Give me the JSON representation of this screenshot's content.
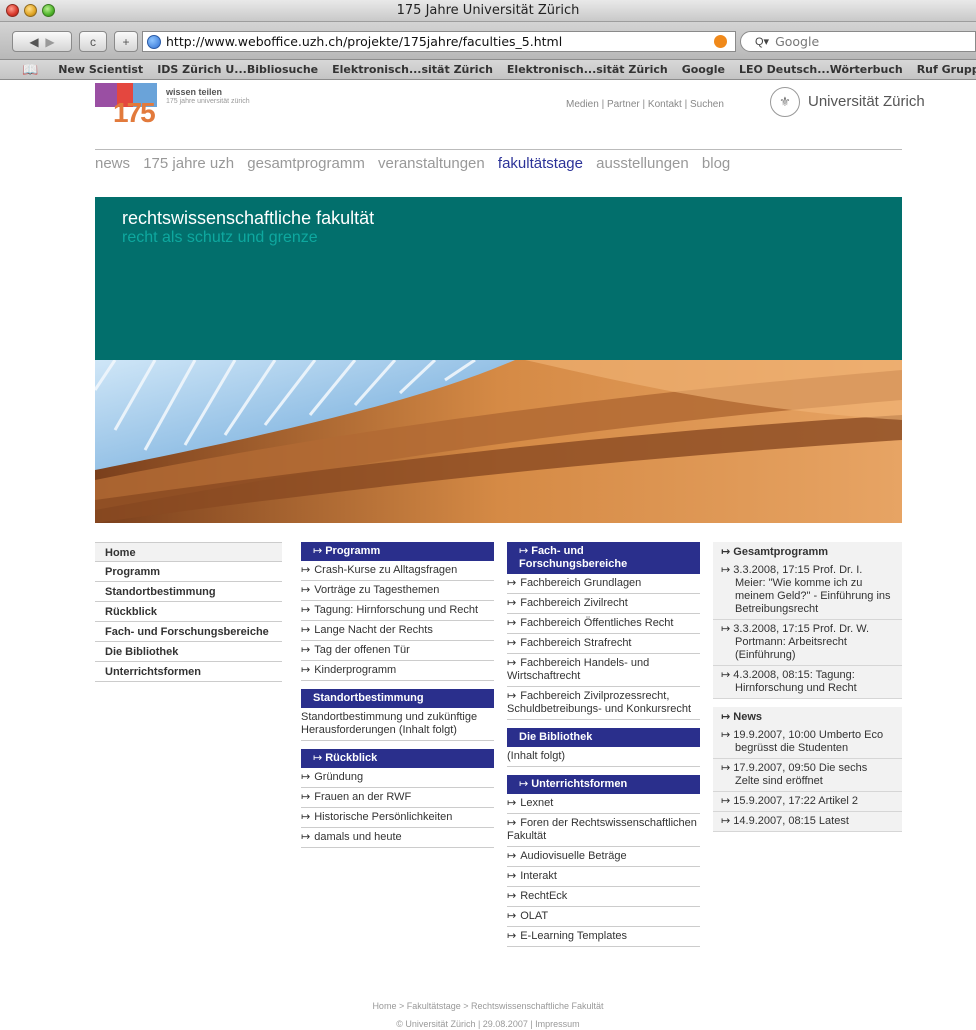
{
  "browser": {
    "window_title": "175 Jahre Universität Zürich",
    "url": "http://www.weboffice.uzh.ch/projekte/175jahre/faculties_5.html",
    "search_placeholder": "Google",
    "bookmarks": [
      "New Scientist",
      "IDS Zürich U...Bibliosuche",
      "Elektronisch...sität Zürich",
      "Elektronisch...sität Zürich",
      "Google",
      "LEO Deutsch...Wörterbuch",
      "Ruf Gruppe"
    ]
  },
  "header": {
    "logo_line1": "wissen teilen",
    "logo_line2": "175 jahre universität zürich",
    "logo_number": "175",
    "toplinks": "Medien | Partner | Kontakt | Suchen",
    "university": "Universität Zürich"
  },
  "mainnav": [
    "news",
    "175 jahre uzh",
    "gesamtprogramm",
    "veranstaltungen",
    "fakultätstage",
    "ausstellungen",
    "blog"
  ],
  "hero": {
    "title": "rechtswissenschaftliche fakultät",
    "subtitle": "recht als schutz und grenze"
  },
  "leftnav": [
    "Home",
    "Programm",
    "Standortbestimmung",
    "Rückblick",
    "Fach- und Forschungsbereiche",
    "Die Bibliothek",
    "Unterrichtsformen"
  ],
  "arrow": "↦",
  "col2": {
    "programm": {
      "title": "Programm",
      "links": [
        "Crash-Kurse zu Alltagsfragen",
        "Vorträge zu Tagesthemen",
        "Tagung: Hirnforschung und Recht",
        "Lange Nacht der Rechts",
        "Tag der offenen Tür",
        "Kinderprogramm"
      ]
    },
    "standort": {
      "title": "Standortbestimmung",
      "text": "Standortbestimmung und zukünftige Herausforderungen (Inhalt folgt)"
    },
    "rueckblick": {
      "title": "Rückblick",
      "links": [
        "Gründung",
        "Frauen an der RWF",
        "Historische Persönlichkeiten",
        "damals und heute"
      ]
    }
  },
  "col3": {
    "fach": {
      "title": "Fach- und Forschungsbereiche",
      "links": [
        "Fachbereich Grundlagen",
        "Fachbereich Zivilrecht",
        "Fachbereich Öffentliches Recht",
        "Fachbereich Strafrecht",
        "Fachbereich Handels- und Wirtschaftrecht",
        "Fachbereich Zivilprozessrecht, Schuldbetreibungs- und Konkursrecht"
      ]
    },
    "bibliothek": {
      "title": "Die Bibliothek",
      "text": "(Inhalt folgt)"
    },
    "unterricht": {
      "title": "Unterrichtsformen",
      "links": [
        "Lexnet",
        "Foren der Rechtswissenschaftlichen Fakultät",
        "Audiovisuelle Beträge",
        "Interakt",
        "RechtEck",
        "OLAT",
        "E-Learning Templates"
      ]
    }
  },
  "right": {
    "gesamt_title": "Gesamtprogramm",
    "gesamt_items": [
      "3.3.2008, 17:15 Prof. Dr. I. Meier: \"Wie komme ich zu meinem Geld?\" - Einführung ins Betreibungsrecht",
      "3.3.2008, 17:15 Prof. Dr. W. Portmann: Arbeitsrecht (Einführung)",
      "4.3.2008, 08:15: Tagung: Hirnforschung und Recht"
    ],
    "news_title": "News",
    "news_items": [
      "19.9.2007, 10:00 Umberto Eco begrüsst die Studenten",
      "17.9.2007, 09:50 Die sechs Zelte sind eröffnet",
      "15.9.2007, 17:22 Artikel 2",
      "14.9.2007, 08:15 Latest"
    ]
  },
  "footer": {
    "breadcrumb": "Home > Fakultätstage > Rechtswissenschaftliche Fakultät",
    "copyright": "© Universität Zürich | 29.08.2007 | Impressum"
  },
  "colors": {
    "nav_blue": "#2a2f8c",
    "hero_teal": "#026f6c",
    "hero_sub": "#0ea89f"
  },
  "icons": [
    "back-icon",
    "forward-icon",
    "reload-icon",
    "add-icon",
    "globe-icon",
    "rss-icon",
    "search-icon",
    "bookmarks-book-icon"
  ]
}
